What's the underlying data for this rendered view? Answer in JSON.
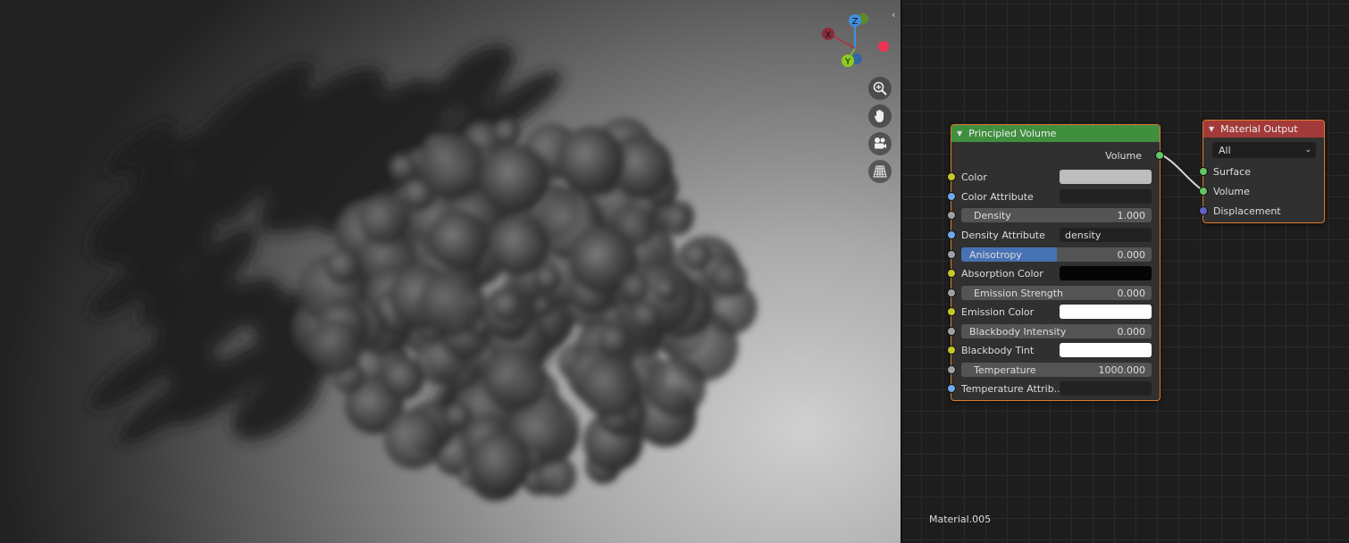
{
  "viewport": {
    "gizmo": {
      "x_label": "X",
      "y_label": "Y",
      "z_label": "Z"
    },
    "nav_icons": [
      "zoom-icon",
      "hand-pan-icon",
      "camera-icon",
      "grid-perspective-icon"
    ]
  },
  "nodes": {
    "principled_volume": {
      "title": "Principled Volume",
      "header_color": "#3f8f3f",
      "output_label": "Volume",
      "inputs": {
        "color": {
          "label": "Color",
          "swatch": "#bdbdbd"
        },
        "color_attribute": {
          "label": "Color Attribute",
          "value": ""
        },
        "density": {
          "label": "Density",
          "value": "1.000"
        },
        "density_attribute": {
          "label": "Density Attribute",
          "value": "density"
        },
        "anisotropy": {
          "label": "Anisotropy",
          "value": "0.000",
          "fill_fraction": 0.5
        },
        "absorption_color": {
          "label": "Absorption Color",
          "swatch": "#050505"
        },
        "emission_strength": {
          "label": "Emission Strength",
          "value": "0.000"
        },
        "emission_color": {
          "label": "Emission Color",
          "swatch": "#ffffff"
        },
        "blackbody_intensity": {
          "label": "Blackbody Intensity",
          "value": "0.000"
        },
        "blackbody_tint": {
          "label": "Blackbody Tint",
          "swatch": "#ffffff"
        },
        "temperature": {
          "label": "Temperature",
          "value": "1000.000"
        },
        "temperature_attribute": {
          "label": "Temperature Attrib...",
          "value": ""
        }
      }
    },
    "material_output": {
      "title": "Material Output",
      "header_color": "#a33a3a",
      "target": "All",
      "inputs": {
        "surface": "Surface",
        "volume": "Volume",
        "displacement": "Displacement"
      }
    }
  },
  "material_name": "Material.005",
  "colors": {
    "node_border": "#e07a2a",
    "link": "#d8d8d8"
  }
}
